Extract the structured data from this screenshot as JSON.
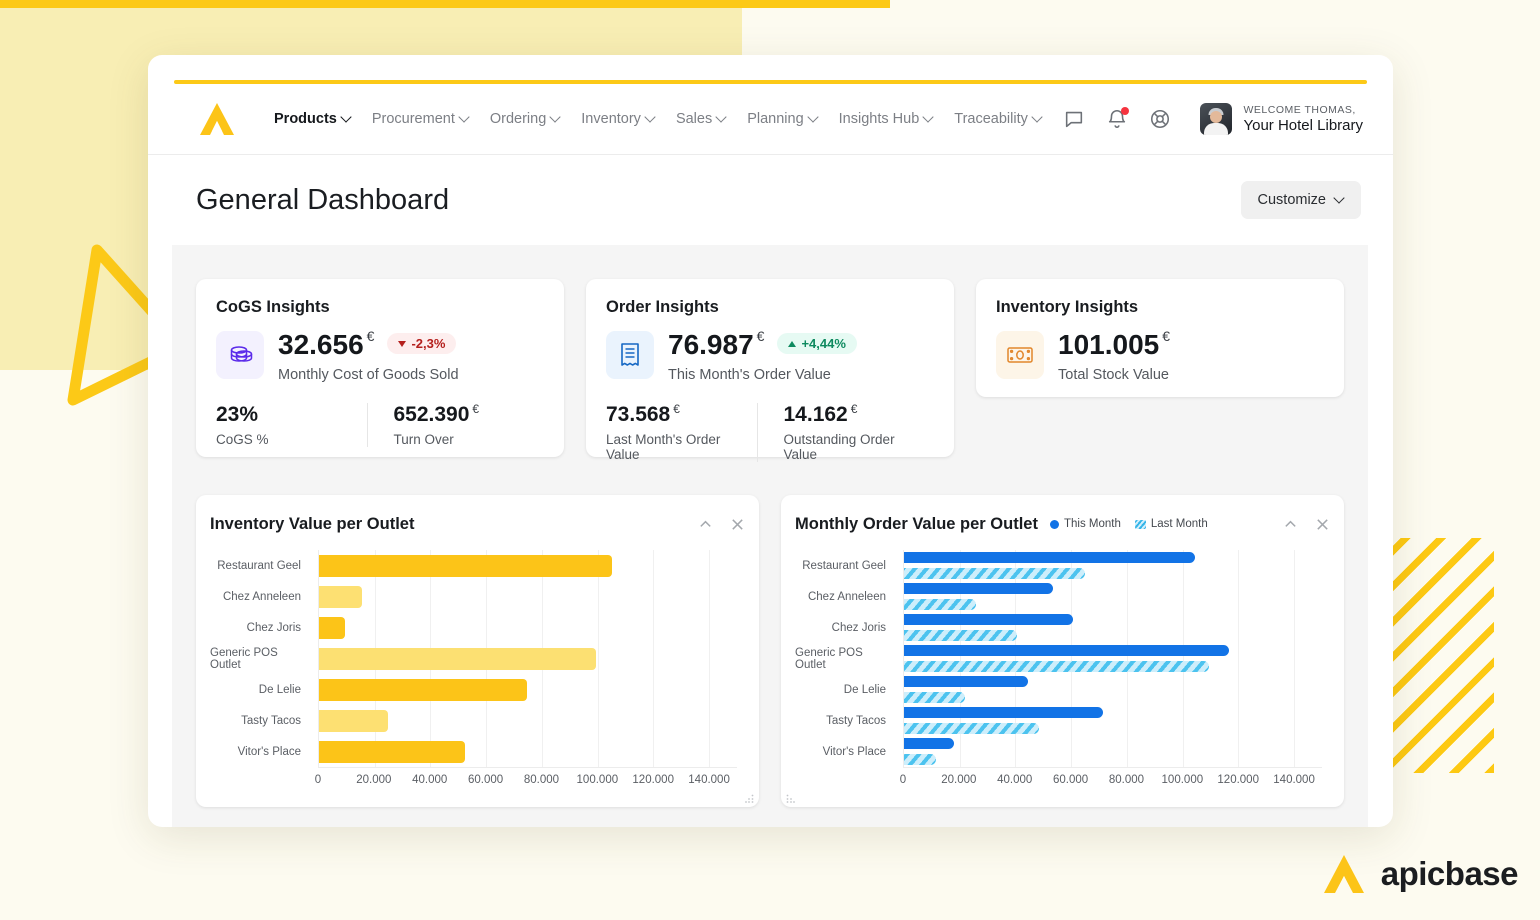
{
  "brand": {
    "name": "apicbase",
    "logo_icon": "apicbase-a-logo"
  },
  "header": {
    "nav": [
      {
        "label": "Products",
        "active": true
      },
      {
        "label": "Procurement",
        "active": false
      },
      {
        "label": "Ordering",
        "active": false
      },
      {
        "label": "Inventory",
        "active": false
      },
      {
        "label": "Sales",
        "active": false
      },
      {
        "label": "Planning",
        "active": false
      },
      {
        "label": "Insights Hub",
        "active": false
      },
      {
        "label": "Traceability",
        "active": false
      }
    ],
    "icons": [
      "chat-icon",
      "bell-icon",
      "lifebuoy-icon"
    ],
    "user": {
      "welcome": "WELCOME THOMAS,",
      "org": "Your Hotel Library"
    }
  },
  "page": {
    "title": "General Dashboard",
    "customize_label": "Customize"
  },
  "kpi_cards": [
    {
      "title": "CoGS Insights",
      "icon": "coins-stack-icon",
      "icon_color": "#5b2bea",
      "value": "32.656",
      "currency": "€",
      "badge": {
        "text": "-2,3%",
        "direction": "down",
        "color": "#b4201d"
      },
      "subtitle": "Monthly Cost of Goods Sold",
      "footer": [
        {
          "value": "23%",
          "currency": "",
          "label": "CoGS %"
        },
        {
          "value": "652.390",
          "currency": "€",
          "label": "Turn Over"
        }
      ]
    },
    {
      "title": "Order Insights",
      "icon": "receipt-icon",
      "icon_color": "#1668c4",
      "value": "76.987",
      "currency": "€",
      "badge": {
        "text": "+4,44%",
        "direction": "up",
        "color": "#0e8a5f"
      },
      "subtitle": "This Month's Order Value",
      "footer": [
        {
          "value": "73.568",
          "currency": "€",
          "label": "Last Month's Order Value"
        },
        {
          "value": "14.162",
          "currency": "€",
          "label": "Outstanding Order Value"
        }
      ]
    },
    {
      "title": "Inventory Insights",
      "icon": "banknote-icon",
      "icon_color": "#e2862a",
      "value": "101.005",
      "currency": "€",
      "badge": null,
      "subtitle": "Total Stock Value",
      "footer": []
    }
  ],
  "chart_data": [
    {
      "type": "bar",
      "orientation": "horizontal",
      "title": "Inventory Value per Outlet",
      "xlabel": "",
      "ylabel": "",
      "xlim": [
        0,
        150000
      ],
      "grid": true,
      "legend": [],
      "tick_labels": [
        "0",
        "20.000",
        "40.000",
        "60.000",
        "80.000",
        "100.000",
        "120.000",
        "140.000"
      ],
      "ticks": [
        0,
        20000,
        40000,
        60000,
        80000,
        100000,
        120000,
        140000
      ],
      "categories": [
        "Restaurant Geel",
        "Chez Anneleen",
        "Chez Joris",
        "Generic POS Outlet",
        "De Lelie",
        "Tasty Tacos",
        "Vitor's Place"
      ],
      "values": [
        105000,
        15500,
        9200,
        99500,
        74500,
        24800,
        52500
      ],
      "bar_colors": [
        "#fcc418",
        "#fde072",
        "#fcc418",
        "#fce072",
        "#fcc418",
        "#fde072",
        "#fcc418"
      ]
    },
    {
      "type": "bar",
      "orientation": "horizontal",
      "title": "Monthly Order Value per Outlet",
      "xlabel": "",
      "ylabel": "",
      "xlim": [
        0,
        150000
      ],
      "grid": true,
      "legend": [
        {
          "name": "This Month",
          "color": "#1273e6",
          "style": "solid"
        },
        {
          "name": "Last Month",
          "color": "#4cc3ef",
          "style": "hatched"
        }
      ],
      "legend_position": "top",
      "tick_labels": [
        "0",
        "20.000",
        "40.000",
        "60.000",
        "80.000",
        "100.000",
        "120.000",
        "140.000"
      ],
      "ticks": [
        0,
        20000,
        40000,
        60000,
        80000,
        100000,
        120000,
        140000
      ],
      "categories": [
        "Restaurant Geel",
        "Chez Anneleen",
        "Chez Joris",
        "Generic POS Outlet",
        "De Lelie",
        "Tasty Tacos",
        "Vitor's Place"
      ],
      "series": [
        {
          "name": "This Month",
          "values": [
            104500,
            53500,
            60500,
            116500,
            44500,
            71500,
            18000
          ]
        },
        {
          "name": "Last Month",
          "values": [
            65000,
            26000,
            40500,
            109500,
            22000,
            48500,
            11500
          ]
        }
      ]
    }
  ],
  "colors": {
    "accent": "#fcc917",
    "pale": "#f8eeb4",
    "canvas": "#fdfbf0",
    "blue": "#1273e6",
    "light_blue": "#4cc3ef"
  }
}
